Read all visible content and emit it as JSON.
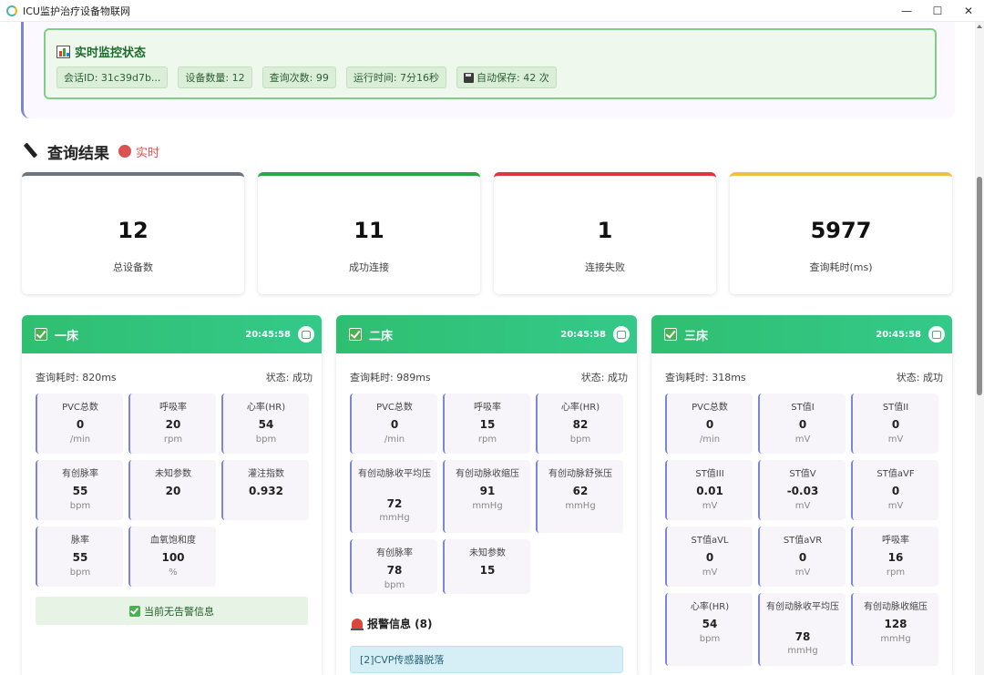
{
  "window": {
    "title": "ICU监护治疗设备物联网",
    "controls": {
      "minimize": "—",
      "maximize": "☐",
      "close": "✕"
    }
  },
  "monitor": {
    "title": "实时监控状态",
    "chips": {
      "session": "会话ID: 31c39d7b...",
      "devices": "设备数量: 12",
      "queries": "查询次数: 99",
      "runtime": "运行时间: 7分16秒",
      "autosave": "自动保存: 42 次"
    }
  },
  "results": {
    "title": "查询结果",
    "live": "实时"
  },
  "stats": [
    {
      "value": "12",
      "label": "总设备数",
      "color": "#6c757d"
    },
    {
      "value": "11",
      "label": "成功连接",
      "color": "#28a745"
    },
    {
      "value": "1",
      "label": "连接失败",
      "color": "#dc3545"
    },
    {
      "value": "5977",
      "label": "查询耗时(ms)",
      "color": "#f0c040"
    }
  ],
  "beds": [
    {
      "name": "一床",
      "time": "20:45:58",
      "query_time": "查询耗时: 820ms",
      "status": "状态: 成功",
      "metrics": [
        {
          "name": "PVC总数",
          "value": "0",
          "unit": "/min"
        },
        {
          "name": "呼吸率",
          "value": "20",
          "unit": "rpm"
        },
        {
          "name": "心率(HR)",
          "value": "54",
          "unit": "bpm"
        },
        {
          "name": "有创脉率",
          "value": "55",
          "unit": "bpm"
        },
        {
          "name": "未知参数",
          "value": "20",
          "unit": ""
        },
        {
          "name": "灌注指数",
          "value": "0.932",
          "unit": ""
        },
        {
          "name": "脉率",
          "value": "55",
          "unit": "bpm"
        },
        {
          "name": "血氧饱和度",
          "value": "100",
          "unit": "%"
        }
      ],
      "no_alarm": "当前无告警信息"
    },
    {
      "name": "二床",
      "time": "20:45:58",
      "query_time": "查询耗时: 989ms",
      "status": "状态: 成功",
      "metrics": [
        {
          "name": "PVC总数",
          "value": "0",
          "unit": "/min"
        },
        {
          "name": "呼吸率",
          "value": "15",
          "unit": "rpm"
        },
        {
          "name": "心率(HR)",
          "value": "82",
          "unit": "bpm"
        },
        {
          "name": "有创动脉收平均压",
          "value": "72",
          "unit": "mmHg"
        },
        {
          "name": "有创动脉收缩压",
          "value": "91",
          "unit": "mmHg"
        },
        {
          "name": "有创动脉舒张压",
          "value": "62",
          "unit": "mmHg"
        },
        {
          "name": "有创脉率",
          "value": "78",
          "unit": "bpm"
        },
        {
          "name": "未知参数",
          "value": "15",
          "unit": ""
        }
      ],
      "alarm_title": "报警信息 (8)",
      "alarm_first": "[2]CVP传感器脱落"
    },
    {
      "name": "三床",
      "time": "20:45:58",
      "query_time": "查询耗时: 318ms",
      "status": "状态: 成功",
      "metrics": [
        {
          "name": "PVC总数",
          "value": "0",
          "unit": "/min"
        },
        {
          "name": "ST值I",
          "value": "0",
          "unit": "mV"
        },
        {
          "name": "ST值II",
          "value": "0",
          "unit": "mV"
        },
        {
          "name": "ST值III",
          "value": "0.01",
          "unit": "mV"
        },
        {
          "name": "ST值V",
          "value": "-0.03",
          "unit": "mV"
        },
        {
          "name": "ST值aVF",
          "value": "0",
          "unit": "mV"
        },
        {
          "name": "ST值aVL",
          "value": "0",
          "unit": "mV"
        },
        {
          "name": "ST值aVR",
          "value": "0",
          "unit": "mV"
        },
        {
          "name": "呼吸率",
          "value": "16",
          "unit": "rpm"
        },
        {
          "name": "心率(HR)",
          "value": "54",
          "unit": "bpm"
        },
        {
          "name": "有创动脉收平均压",
          "value": "78",
          "unit": "mmHg"
        },
        {
          "name": "有创动脉收缩压",
          "value": "128",
          "unit": "mmHg"
        }
      ]
    }
  ]
}
